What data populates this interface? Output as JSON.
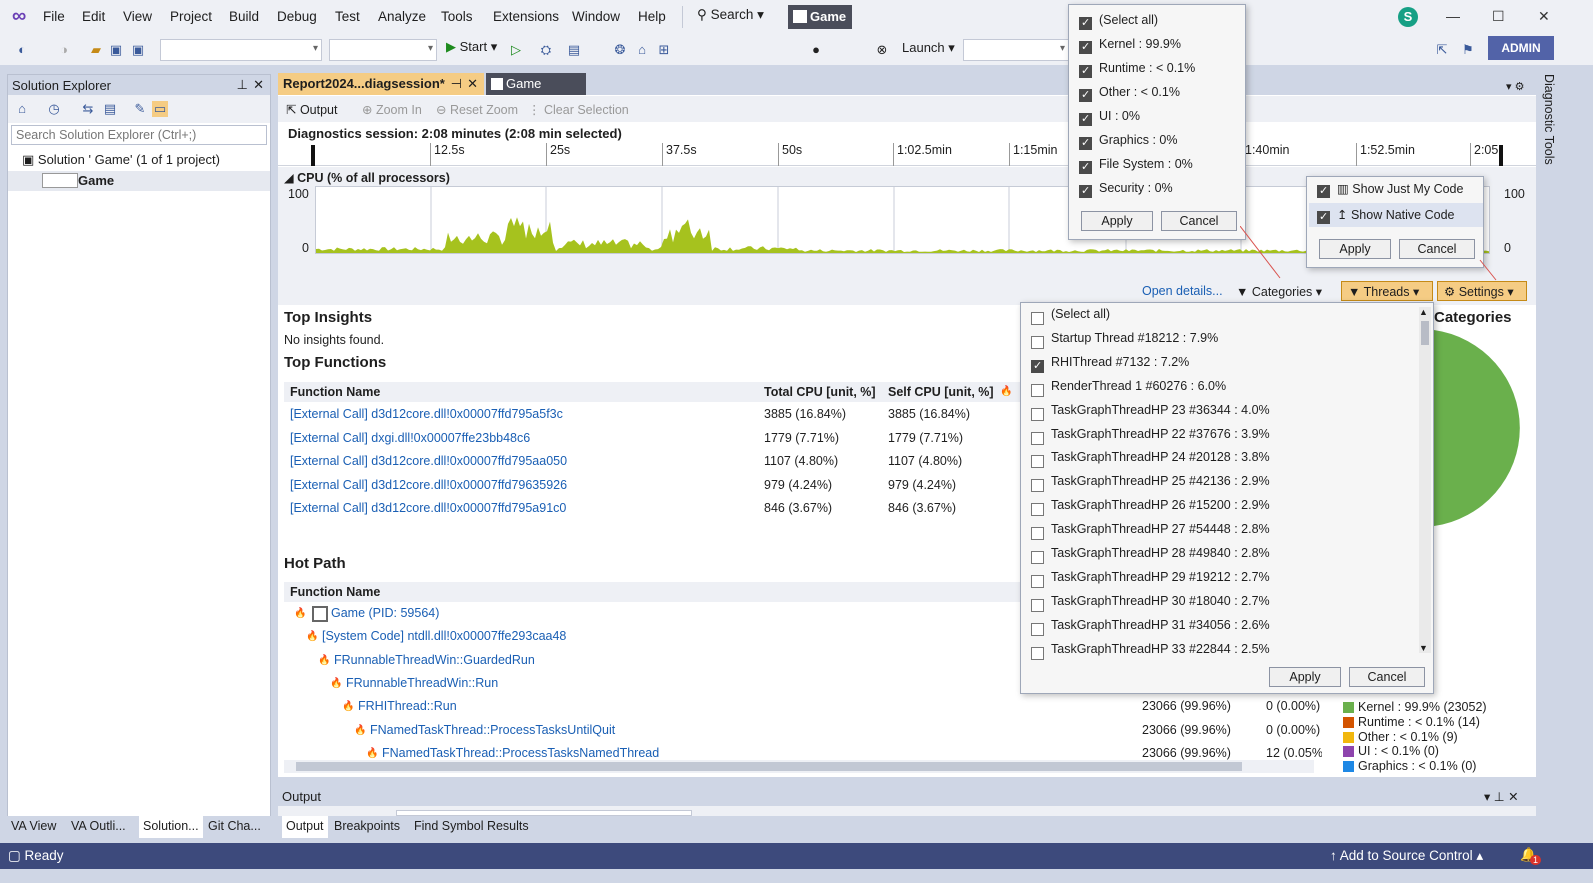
{
  "menu": [
    "File",
    "Edit",
    "View",
    "Project",
    "Build",
    "Debug",
    "Test",
    "Analyze",
    "Tools",
    "Extensions",
    "Window",
    "Help"
  ],
  "search_label": "Search",
  "app_name": "Game",
  "avatar_letter": "S",
  "toolbar": {
    "start_label": "Start",
    "launch_label": "Launch",
    "admin_label": "ADMIN"
  },
  "solution_explorer": {
    "title": "Solution Explorer",
    "search_placeholder": "Search Solution Explorer (Ctrl+;)",
    "solution_item": "Solution '  Game' (1 of 1 project)",
    "project_item": "Game",
    "bottom_tabs": [
      "VA View",
      "VA Outli...",
      "Solution...",
      "Git Cha..."
    ]
  },
  "doc_tabs": {
    "report": "Report2024...diagsession*",
    "game": "Game"
  },
  "doc_tools": {
    "output": "Output",
    "zoom_in": "Zoom In",
    "reset_zoom": "Reset Zoom",
    "clear_selection": "Clear Selection"
  },
  "session_label": "Diagnostics session: 2:08 minutes (2:08 min selected)",
  "ruler_ticks": [
    "12.5s",
    "25s",
    "37.5s",
    "50s",
    "1:02.5min",
    "1:15min",
    "1:27.5min",
    "1:40min",
    "1:52.5min",
    "2:05"
  ],
  "cpu": {
    "title": "CPU (% of all processors)",
    "ymax": "100",
    "ymin": "0",
    "activity_color": "#a6c21e"
  },
  "filter_bar": {
    "open_details": "Open details...",
    "categories": "Categories",
    "threads": "Threads",
    "settings": "Settings"
  },
  "top_insights": {
    "title": "Top Insights",
    "message": "No insights found."
  },
  "top_functions": {
    "title": "Top Functions",
    "headers": [
      "Function Name",
      "Total CPU [unit, %]",
      "Self CPU [unit, %]"
    ],
    "rows": [
      {
        "name": "[External Call] d3d12core.dll!0x00007ffd795a5f3c",
        "total": "3885 (16.84%)",
        "self": "3885 (16.84%)"
      },
      {
        "name": "[External Call] dxgi.dll!0x00007ffe23bb48c6",
        "total": "1779 (7.71%)",
        "self": "1779 (7.71%)"
      },
      {
        "name": "[External Call] d3d12core.dll!0x00007ffd795aa050",
        "total": "1107 (4.80%)",
        "self": "1107 (4.80%)"
      },
      {
        "name": "[External Call] d3d12core.dll!0x00007ffd79635926",
        "total": "979 (4.24%)",
        "self": "979 (4.24%)"
      },
      {
        "name": "[External Call] d3d12core.dll!0x00007ffd795a91c0",
        "total": "846 (3.67%)",
        "self": "846 (3.67%)"
      }
    ]
  },
  "hot_path": {
    "title": "Hot Path",
    "header": "Function Name",
    "rows": [
      {
        "name": "Game (PID: 59564)",
        "total": "",
        "self": ""
      },
      {
        "name": "[System Code] ntdll.dll!0x00007ffe293caa48",
        "total": "",
        "self": ""
      },
      {
        "name": "FRunnableThreadWin::GuardedRun",
        "total": "",
        "self": ""
      },
      {
        "name": "FRunnableThreadWin::Run",
        "total": "",
        "self": ""
      },
      {
        "name": "FRHIThread::Run",
        "total": "23066 (99.96%)",
        "self": "0 (0.00%)"
      },
      {
        "name": "FNamedTaskThread::ProcessTasksUntilQuit",
        "total": "23066 (99.96%)",
        "self": "0 (0.00%)"
      },
      {
        "name": "FNamedTaskThread::ProcessTasksNamedThread",
        "total": "23066 (99.96%)",
        "self": "12 (0.05%"
      }
    ]
  },
  "categories_panel": {
    "title": "Categories",
    "legend": [
      {
        "label": "Kernel : 99.9% (23052)",
        "color": "#6ab04c"
      },
      {
        "label": "Runtime : < 0.1% (14)",
        "color": "#d35400"
      },
      {
        "label": "Other : < 0.1% (9)",
        "color": "#f1b70e"
      },
      {
        "label": "UI : < 0.1% (0)",
        "color": "#8e44ad"
      },
      {
        "label": "Graphics : < 0.1% (0)",
        "color": "#1e88e5"
      }
    ]
  },
  "categories_popup": {
    "items": [
      "(Select all)",
      "Kernel : 99.9%",
      "Runtime : < 0.1%",
      "Other : < 0.1%",
      "UI : 0%",
      "Graphics : 0%",
      "File System : 0%",
      "Security : 0%"
    ],
    "apply": "Apply",
    "cancel": "Cancel"
  },
  "settings_popup": {
    "items": [
      "Show Just My Code",
      "Show Native Code"
    ],
    "apply": "Apply",
    "cancel": "Cancel"
  },
  "threads_popup": {
    "items": [
      {
        "label": "(Select all)",
        "checked": false
      },
      {
        "label": "Startup Thread #18212 : 7.9%",
        "checked": false
      },
      {
        "label": "RHIThread #7132 : 7.2%",
        "checked": true
      },
      {
        "label": "RenderThread 1 #60276 : 6.0%",
        "checked": false
      },
      {
        "label": "TaskGraphThreadHP 23 #36344 : 4.0%",
        "checked": false
      },
      {
        "label": "TaskGraphThreadHP 22 #37676 : 3.9%",
        "checked": false
      },
      {
        "label": "TaskGraphThreadHP 24 #20128 : 3.8%",
        "checked": false
      },
      {
        "label": "TaskGraphThreadHP 25 #42136 : 2.9%",
        "checked": false
      },
      {
        "label": "TaskGraphThreadHP 26 #15200 : 2.9%",
        "checked": false
      },
      {
        "label": "TaskGraphThreadHP 27 #54448 : 2.8%",
        "checked": false
      },
      {
        "label": "TaskGraphThreadHP 28 #49840 : 2.8%",
        "checked": false
      },
      {
        "label": "TaskGraphThreadHP 29 #19212 : 2.7%",
        "checked": false
      },
      {
        "label": "TaskGraphThreadHP 30 #18040 : 2.7%",
        "checked": false
      },
      {
        "label": "TaskGraphThreadHP 31 #34056 : 2.6%",
        "checked": false
      },
      {
        "label": "TaskGraphThreadHP 33 #22844 : 2.5%",
        "checked": false
      }
    ],
    "apply": "Apply",
    "cancel": "Cancel"
  },
  "output_panel": {
    "title": "Output",
    "tabs": [
      "Output",
      "Breakpoints",
      "Find Symbol Results"
    ]
  },
  "right_strip_label": "Diagnostic Tools",
  "status": {
    "ready": "Ready",
    "source_control": "Add to Source Control",
    "notification_count": "1"
  }
}
